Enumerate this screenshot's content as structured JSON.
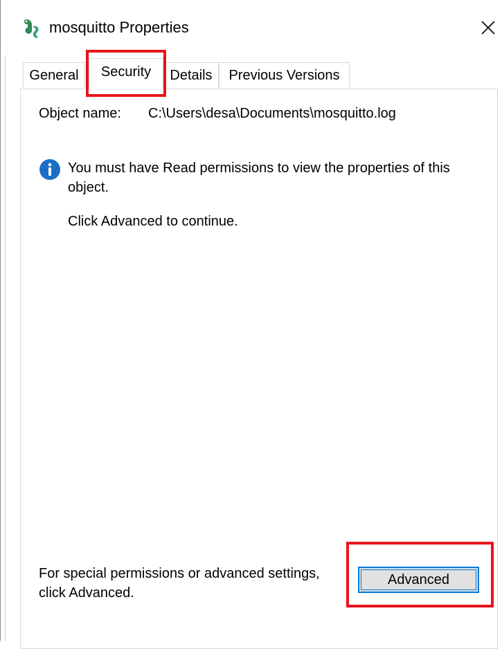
{
  "window": {
    "title": "mosquitto Properties",
    "app_icon": "mosquitto-app-icon",
    "close_icon": "close-icon"
  },
  "tabs": [
    {
      "label": "General",
      "active": false
    },
    {
      "label": "Security",
      "active": true
    },
    {
      "label": "Details",
      "active": false
    },
    {
      "label": "Previous Versions",
      "active": false
    }
  ],
  "security": {
    "object_name_label": "Object name:",
    "object_name_value": "C:\\Users\\desa\\Documents\\mosquitto.log",
    "info_icon": "info-icon",
    "info_message": "You must have Read permissions to view the properties of this object.",
    "continue_text": "Click Advanced to continue.",
    "special_permissions_text": "For special permissions or advanced settings, click Advanced.",
    "advanced_button_label": "Advanced"
  },
  "colors": {
    "highlight": "#e8141b",
    "button_focus": "#0078d7",
    "info_icon": "#1a6fc4",
    "tab_border": "#d9d9d9"
  }
}
